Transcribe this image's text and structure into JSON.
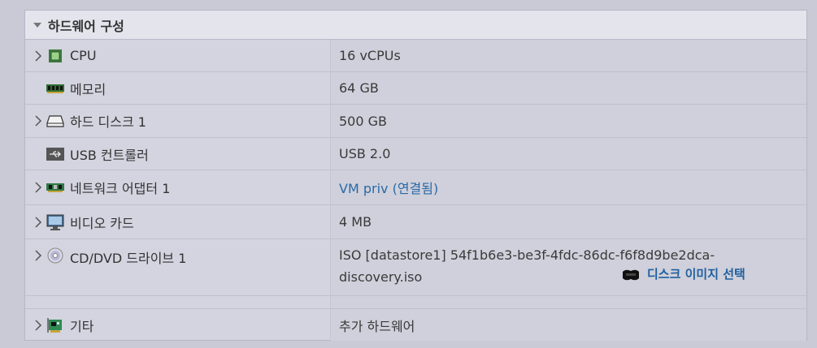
{
  "section": {
    "title": "하드웨어 구성"
  },
  "rows": [
    {
      "label": "CPU",
      "value": "16 vCPUs",
      "expandable": true,
      "icon": "cpu-icon"
    },
    {
      "label": "메모리",
      "value": "64 GB",
      "expandable": false,
      "icon": "memory-icon"
    },
    {
      "label": "하드 디스크 1",
      "value": "500 GB",
      "expandable": true,
      "icon": "hard-disk-icon"
    },
    {
      "label": "USB 컨트롤러",
      "value": "USB 2.0",
      "expandable": false,
      "icon": "usb-icon"
    },
    {
      "label": "네트워크 어댑터 1",
      "value": "VM priv (연결됨)",
      "expandable": true,
      "icon": "network-adapter-icon"
    },
    {
      "label": "비디오 카드",
      "value": "4 MB",
      "expandable": true,
      "icon": "monitor-icon"
    },
    {
      "label": "CD/DVD 드라이브 1",
      "value_line1": "ISO [datastore1] 54f1b6e3-be3f-4fdc-86dc-f6f8d9be2dca-",
      "value_line2": "discovery.iso",
      "action_label": "디스크 이미지 선택",
      "expandable": true,
      "icon": "cd-dvd-icon"
    },
    {
      "label": "기타",
      "value": "추가 하드웨어",
      "expandable": true,
      "icon": "pci-card-icon"
    }
  ],
  "colors": {
    "link": "#2a6aa6",
    "action": "#1f5f9e",
    "background": "#c9cad6"
  }
}
